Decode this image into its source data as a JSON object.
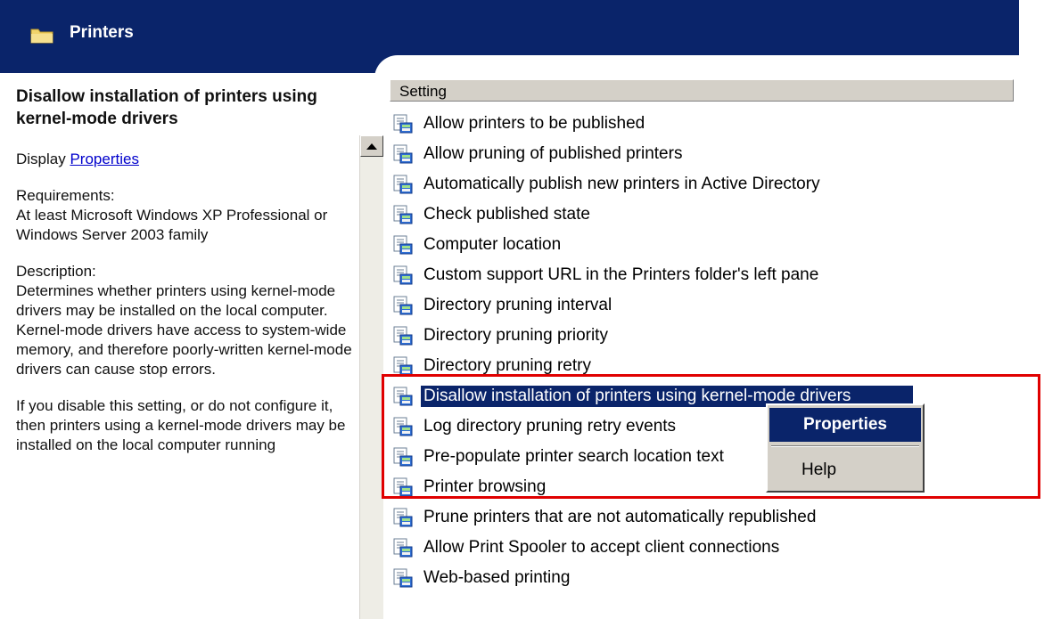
{
  "header": {
    "title": "Printers",
    "icon": "folder-icon"
  },
  "left_pane": {
    "policy_title": "Disallow installation of printers using kernel-mode drivers",
    "display_prefix": "Display ",
    "display_link": "Properties",
    "requirements_label": "Requirements:",
    "requirements_text": "At least Microsoft Windows XP Professional or Windows Server 2003 family",
    "description_label": "Description:",
    "description_text": "Determines whether printers using kernel-mode drivers may be installed on the local computer.  Kernel-mode drivers have access to system-wide memory, and therefore poorly-written kernel-mode drivers can cause stop errors.",
    "disable_text": "If you disable this setting, or do not configure it, then printers using a kernel-mode drivers may be installed on the local computer running"
  },
  "list": {
    "column_header": "Setting",
    "items": [
      "Allow printers to be published",
      "Allow pruning of published printers",
      "Automatically publish new printers in Active Directory",
      "Check published state",
      "Computer location",
      "Custom support URL in the Printers folder's left pane",
      "Directory pruning interval",
      "Directory pruning priority",
      "Directory pruning retry",
      "Disallow installation of printers using kernel-mode drivers",
      "Log directory pruning retry events",
      "Pre-populate printer search location text",
      "Printer browsing",
      "Prune printers that are not automatically republished",
      "Allow Print Spooler to accept client connections",
      "Web-based printing"
    ],
    "selected_index": 9,
    "item_icon": "policy-setting-icon"
  },
  "context_menu": {
    "properties": "Properties",
    "help": "Help"
  },
  "colors": {
    "title_bar": "#0a246a",
    "highlight_frame": "#e00000",
    "menu_bg": "#d4d0c8"
  }
}
